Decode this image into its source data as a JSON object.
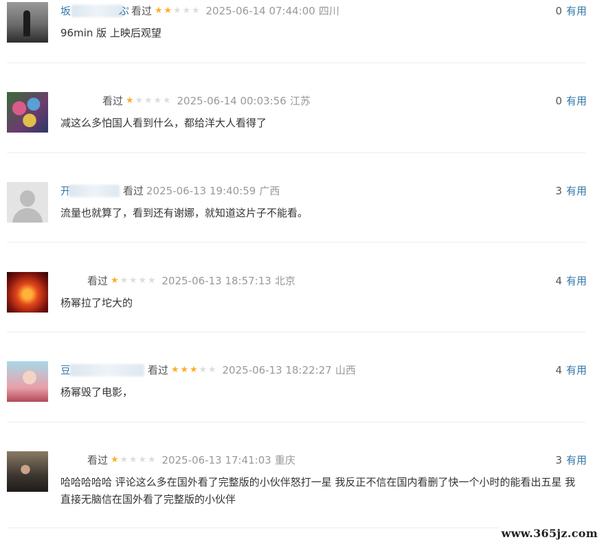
{
  "comments": [
    {
      "user": "坂",
      "user_tail": "ぷ",
      "watched": "看过",
      "rating": 2,
      "time": "2025-06-14 07:44:00",
      "location": "四川",
      "useful_count": "0",
      "useful_label": "有用",
      "content": "96min 版 上映后观望",
      "avatar": "a1"
    },
    {
      "user": "",
      "user_tail": "",
      "watched": "看过",
      "rating": 1,
      "time": "2025-06-14 00:03:56",
      "location": "江苏",
      "useful_count": "0",
      "useful_label": "有用",
      "content": "减这么多怕国人看到什么，都给洋大人看得了",
      "avatar": "a2"
    },
    {
      "user": "开",
      "user_tail": "",
      "watched": "看过",
      "rating": 0,
      "time": "2025-06-13 19:40:59",
      "location": "广西",
      "useful_count": "3",
      "useful_label": "有用",
      "content": "流量也就算了，看到还有谢娜，就知道这片子不能看。",
      "avatar": "a3"
    },
    {
      "user": "",
      "user_tail": "",
      "watched": "看过",
      "rating": 1,
      "time": "2025-06-13 18:57:13",
      "location": "北京",
      "useful_count": "4",
      "useful_label": "有用",
      "content": "杨幂拉了坨大的",
      "avatar": "a4"
    },
    {
      "user": "豆",
      "user_tail": "",
      "watched": "看过",
      "rating": 3,
      "time": "2025-06-13 18:22:27",
      "location": "山西",
      "useful_count": "4",
      "useful_label": "有用",
      "content": "杨幂毁了电影，",
      "avatar": "a5"
    },
    {
      "user": "",
      "user_tail": "",
      "watched": "看过",
      "rating": 1,
      "time": "2025-06-13 17:41:03",
      "location": "重庆",
      "useful_count": "3",
      "useful_label": "有用",
      "content": "哈哈哈哈哈 评论这么多在国外看了完整版的小伙伴怒打一星 我反正不信在国内看删了快一个小时的能看出五星 我直接无脑信在国外看了完整版的小伙伴",
      "avatar": "a6"
    }
  ],
  "watermark": "www.365jz.com",
  "colors": {
    "star_on": "#ffac2d",
    "star_off": "#dddddd",
    "link": "#3377aa",
    "meta": "#999999"
  }
}
